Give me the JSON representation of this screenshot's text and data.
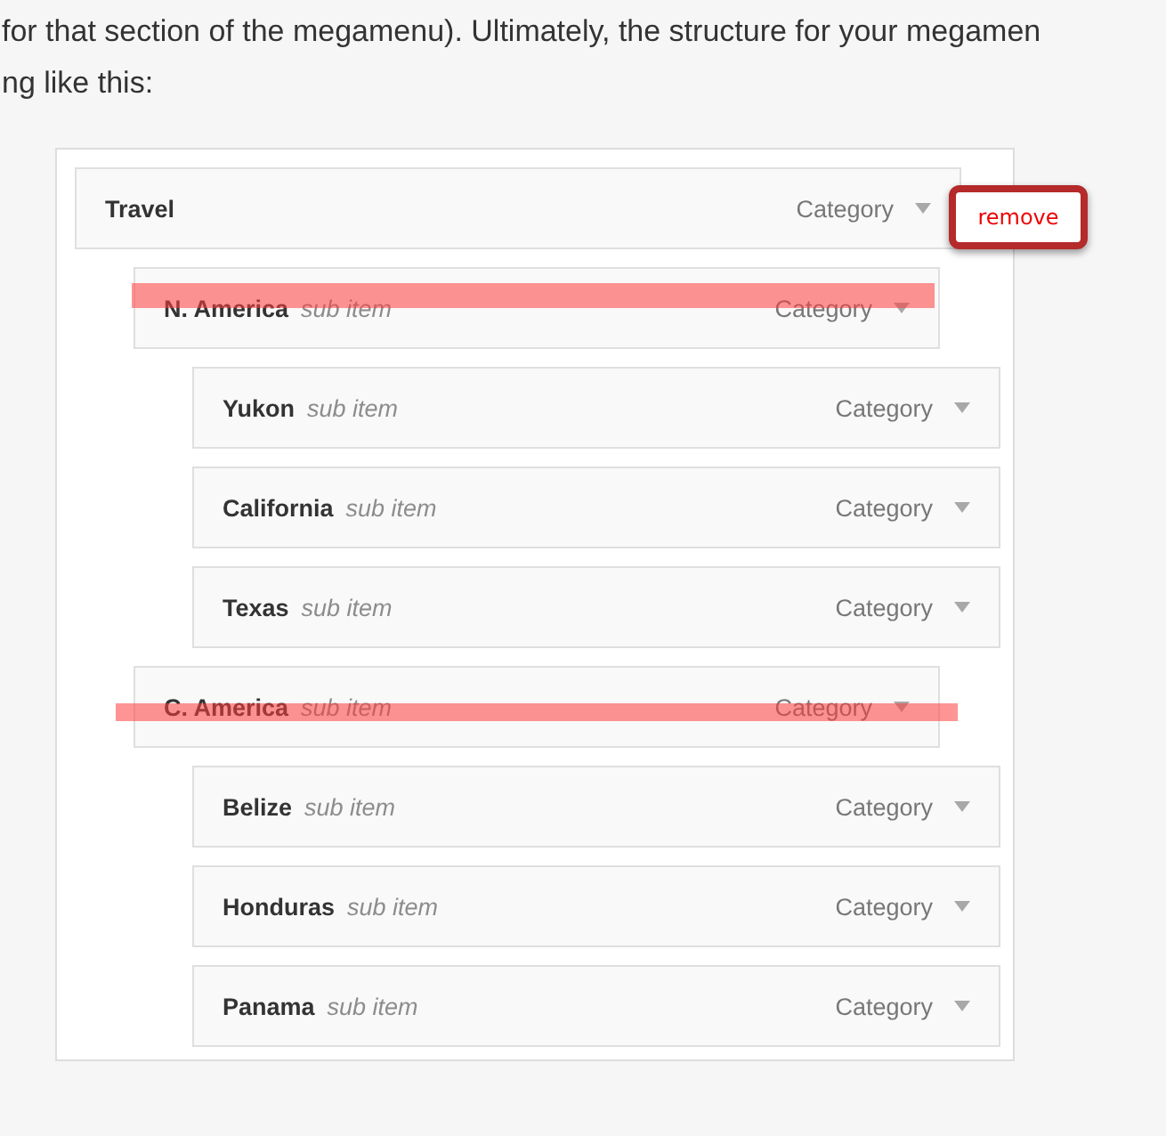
{
  "intro_lines": [
    "for that section of the megamenu). Ultimately, the structure for your megamen",
    "ng like this:"
  ],
  "menu": {
    "items": [
      {
        "label": "Travel",
        "type_label": "Category",
        "struck": false,
        "children": [
          {
            "label": "N. America",
            "note": "sub item",
            "type_label": "Category",
            "struck": true,
            "children": [
              {
                "label": "Yukon",
                "note": "sub item",
                "type_label": "Category",
                "struck": false
              },
              {
                "label": "California",
                "note": "sub item",
                "type_label": "Category",
                "struck": false
              },
              {
                "label": "Texas",
                "note": "sub item",
                "type_label": "Category",
                "struck": false
              }
            ]
          },
          {
            "label": "C. America",
            "note": "sub item",
            "type_label": "Category",
            "struck": true,
            "children": [
              {
                "label": "Belize",
                "note": "sub item",
                "type_label": "Category",
                "struck": false
              },
              {
                "label": "Honduras",
                "note": "sub item",
                "type_label": "Category",
                "struck": false
              },
              {
                "label": "Panama",
                "note": "sub item",
                "type_label": "Category",
                "struck": false
              }
            ]
          }
        ]
      }
    ],
    "remove_button": "remove"
  }
}
